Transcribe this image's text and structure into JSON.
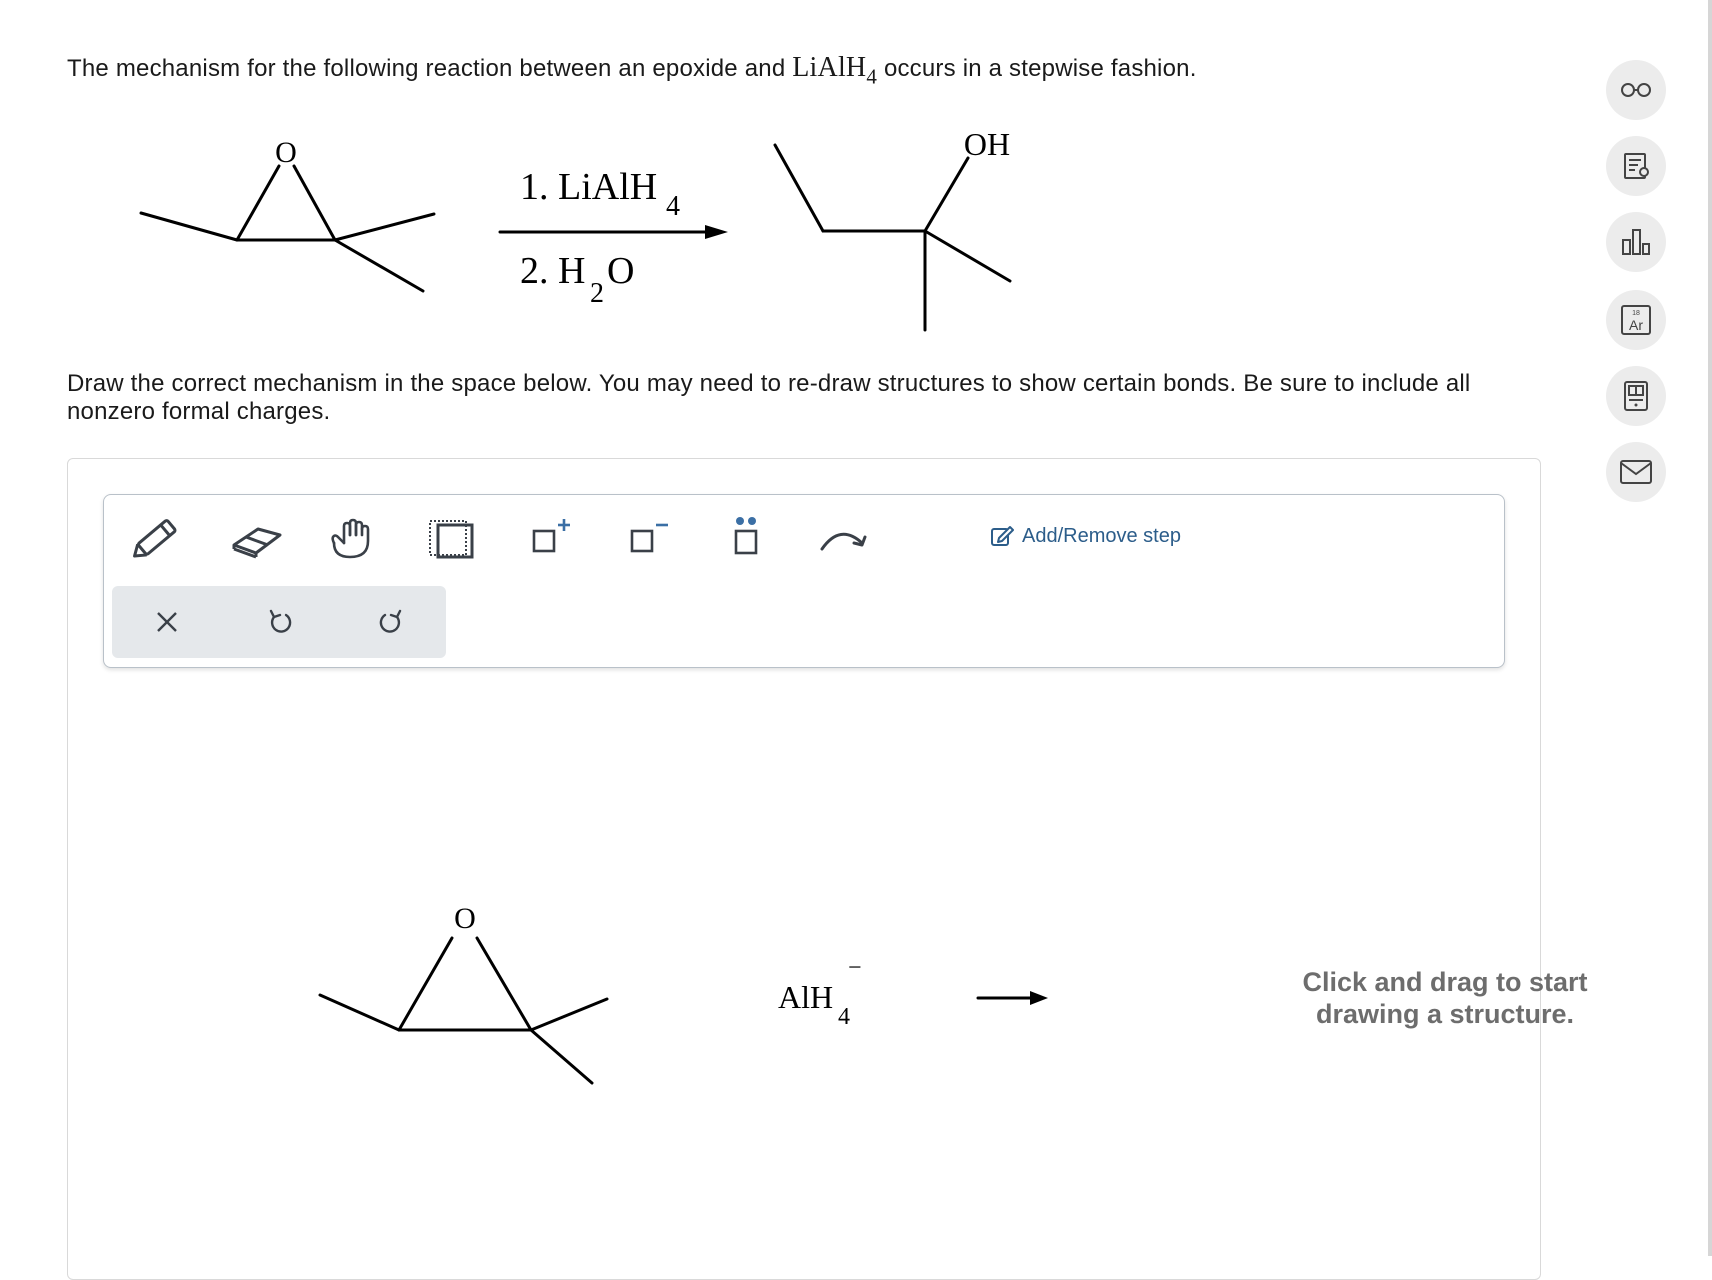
{
  "question": {
    "prompt_before": "The mechanism for the following reaction between an epoxide and",
    "reagent_main": "LiAlH",
    "reagent_sub": "4",
    "prompt_after": "occurs in a stepwise fashion.",
    "instructions": "Draw the correct mechanism in the space below. You may need to re-draw structures to show certain bonds. Be sure to include all nonzero formal charges."
  },
  "reaction": {
    "reactant_oxygen_label": "O",
    "step1_text": "1. LiAlH",
    "step1_sub": "4",
    "step2_text": "2. H",
    "step2_sub": "2",
    "step2_tail": "O",
    "product_label": "OH"
  },
  "toolbar": {
    "tools": [
      "pencil",
      "eraser",
      "hand",
      "selection",
      "positive-charge",
      "negative-charge",
      "lone-pair",
      "curved-arrow"
    ],
    "add_remove_label": "Add/Remove step"
  },
  "actions": [
    "clear",
    "undo",
    "redo"
  ],
  "canvas": {
    "epoxide_oxygen_label": "O",
    "reagent_main": "AlH",
    "reagent_sub": "4",
    "reagent_charge": "−",
    "hint_line1": "Click and drag to start",
    "hint_line2": "drawing a structure."
  },
  "sidebar": {
    "buttons": [
      "glasses-icon",
      "notes-icon",
      "bar-chart-icon",
      "periodic-table-icon",
      "calculator-icon",
      "mail-icon"
    ],
    "periodic_mass": "18",
    "periodic_symbol": "Ar"
  }
}
